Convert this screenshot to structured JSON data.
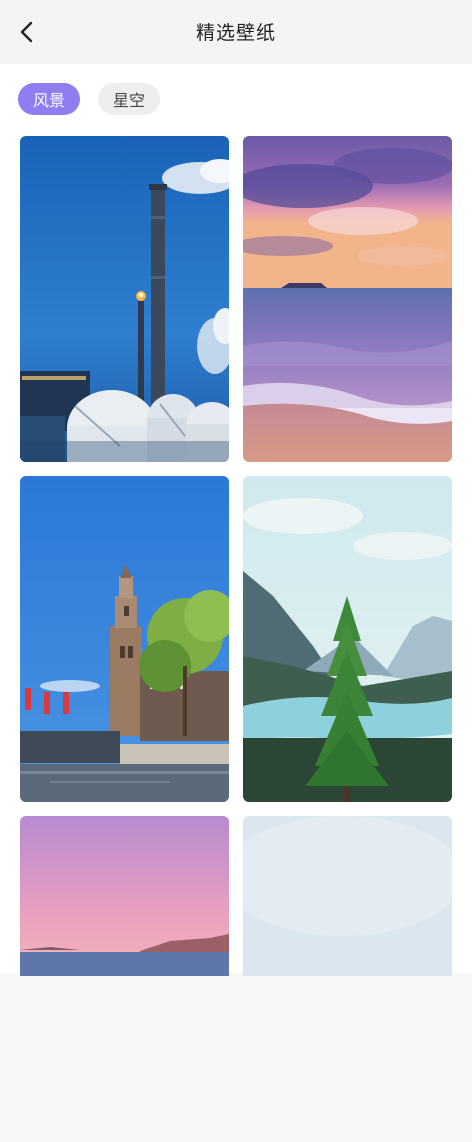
{
  "header": {
    "title": "精选壁纸",
    "back_icon": "back-arrow-icon"
  },
  "tabs": [
    {
      "label": "风景",
      "selected": true
    },
    {
      "label": "星空",
      "selected": false
    }
  ],
  "colors": {
    "accent": "#8f7df2",
    "chip_inactive": "#eeeeee"
  },
  "wallpapers": [
    {
      "scene": "industrial-chimney-blue-sky"
    },
    {
      "scene": "purple-sunset-beach"
    },
    {
      "scene": "church-tower-canal"
    },
    {
      "scene": "pine-tree-mountain-lake"
    },
    {
      "scene": "pink-sky-sea-island"
    },
    {
      "scene": "pale-blue-sky"
    }
  ]
}
